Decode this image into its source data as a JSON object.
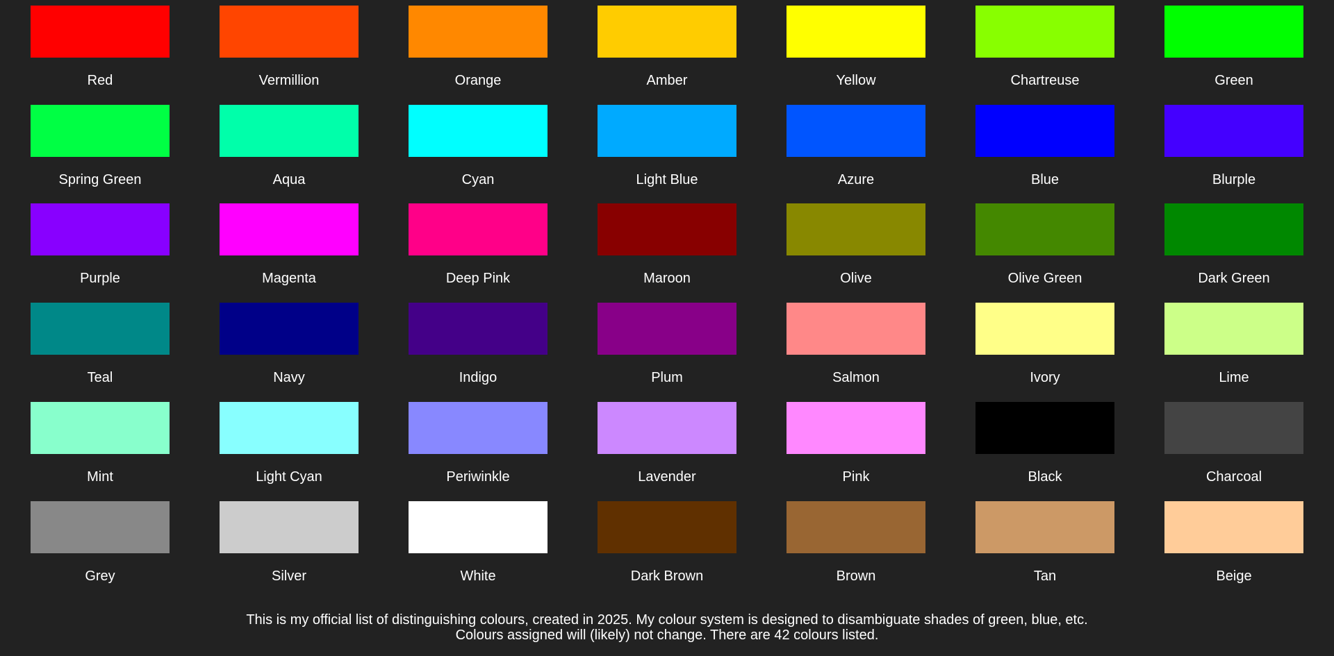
{
  "swatches": [
    {
      "name": "Red",
      "color": "#ff0000"
    },
    {
      "name": "Vermillion",
      "color": "#ff4500"
    },
    {
      "name": "Orange",
      "color": "#ff8800"
    },
    {
      "name": "Amber",
      "color": "#ffcc00"
    },
    {
      "name": "Yellow",
      "color": "#ffff00"
    },
    {
      "name": "Chartreuse",
      "color": "#88ff00"
    },
    {
      "name": "Green",
      "color": "#00ff00"
    },
    {
      "name": "Spring Green",
      "color": "#00ff44"
    },
    {
      "name": "Aqua",
      "color": "#00ffaa"
    },
    {
      "name": "Cyan",
      "color": "#00ffff"
    },
    {
      "name": "Light Blue",
      "color": "#00aaff"
    },
    {
      "name": "Azure",
      "color": "#0055ff"
    },
    {
      "name": "Blue",
      "color": "#0000ff"
    },
    {
      "name": "Blurple",
      "color": "#4400ff"
    },
    {
      "name": "Purple",
      "color": "#8800ff"
    },
    {
      "name": "Magenta",
      "color": "#ff00ff"
    },
    {
      "name": "Deep Pink",
      "color": "#ff0088"
    },
    {
      "name": "Maroon",
      "color": "#880000"
    },
    {
      "name": "Olive",
      "color": "#888800"
    },
    {
      "name": "Olive Green",
      "color": "#448800"
    },
    {
      "name": "Dark Green",
      "color": "#008800"
    },
    {
      "name": "Teal",
      "color": "#008888"
    },
    {
      "name": "Navy",
      "color": "#000088"
    },
    {
      "name": "Indigo",
      "color": "#440088"
    },
    {
      "name": "Plum",
      "color": "#880088"
    },
    {
      "name": "Salmon",
      "color": "#ff8888"
    },
    {
      "name": "Ivory",
      "color": "#ffff88"
    },
    {
      "name": "Lime",
      "color": "#ccff88"
    },
    {
      "name": "Mint",
      "color": "#88ffcc"
    },
    {
      "name": "Light Cyan",
      "color": "#88ffff"
    },
    {
      "name": "Periwinkle",
      "color": "#8888ff"
    },
    {
      "name": "Lavender",
      "color": "#cc88ff"
    },
    {
      "name": "Pink",
      "color": "#ff88ff"
    },
    {
      "name": "Black",
      "color": "#000000"
    },
    {
      "name": "Charcoal",
      "color": "#444444"
    },
    {
      "name": "Grey",
      "color": "#888888"
    },
    {
      "name": "Silver",
      "color": "#cccccc"
    },
    {
      "name": "White",
      "color": "#ffffff"
    },
    {
      "name": "Dark Brown",
      "color": "#603000"
    },
    {
      "name": "Brown",
      "color": "#996633"
    },
    {
      "name": "Tan",
      "color": "#cc9966"
    },
    {
      "name": "Beige",
      "color": "#ffcc99"
    }
  ],
  "footer": {
    "line1": "This is my official list of distinguishing colours, created in 2025. My colour system is designed to disambiguate shades of green, blue, etc.",
    "line2": "Colours assigned will (likely) not change. There are 42 colours listed."
  }
}
